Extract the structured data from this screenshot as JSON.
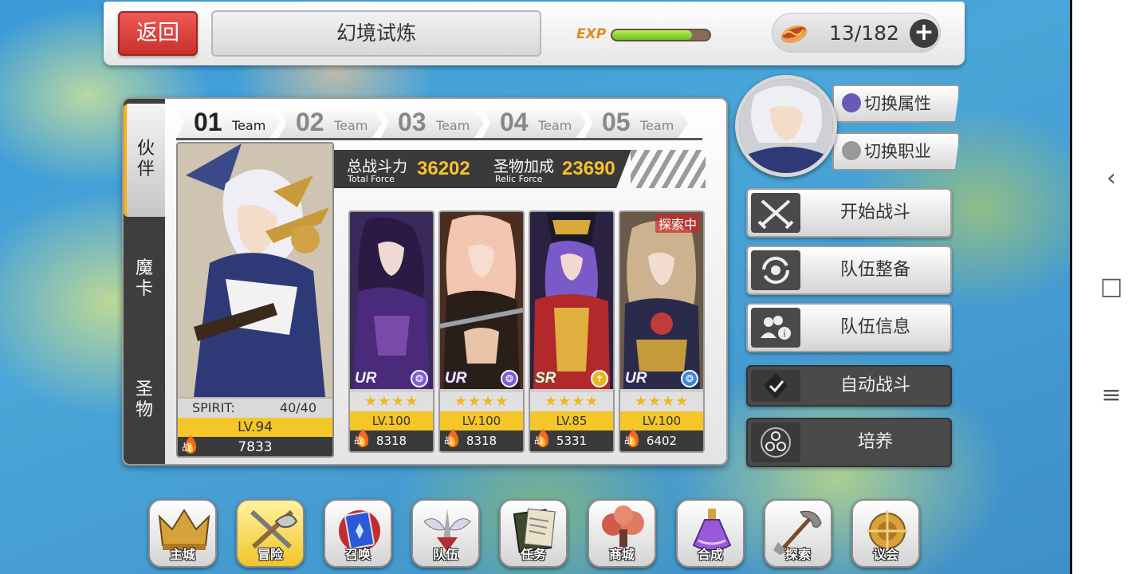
{
  "topbar": {
    "back_label": "返回",
    "title": "幻境试炼",
    "exp_label": "EXP",
    "exp_progress": 0.82,
    "stamina": "13/182",
    "plus_label": "+"
  },
  "side_tabs": [
    {
      "label": "伙\n伴",
      "active": true
    },
    {
      "label": "魔\n卡",
      "active": false
    },
    {
      "label": "圣\n物",
      "active": false
    }
  ],
  "teams": [
    {
      "num": "01",
      "word": "Team",
      "active": true
    },
    {
      "num": "02",
      "word": "Team",
      "active": false
    },
    {
      "num": "03",
      "word": "Team",
      "active": false
    },
    {
      "num": "04",
      "word": "Team",
      "active": false
    },
    {
      "num": "05",
      "word": "Team",
      "active": false
    }
  ],
  "force": {
    "total_label": "总战斗力",
    "total_sub": "Total Force",
    "total_value": "36202",
    "relic_label": "圣物加成",
    "relic_sub": "Relic Force",
    "relic_value": "23690"
  },
  "leader": {
    "spirit_label": "SPIRIT:",
    "spirit_value": "40/40",
    "level": "LV.94",
    "power": "7833",
    "power_mark": "战"
  },
  "members": [
    {
      "rarity": "UR",
      "stars": "★★★★",
      "level": "LV.100",
      "power": "8318",
      "power_mark": "战",
      "attr_color": "#7b5fd0",
      "badge": ""
    },
    {
      "rarity": "UR",
      "stars": "★★★★",
      "level": "LV.100",
      "power": "8318",
      "power_mark": "战",
      "attr_color": "#7b5fd0",
      "badge": ""
    },
    {
      "rarity": "SR",
      "stars": "★★★★",
      "level": "LV.85",
      "power": "5331",
      "power_mark": "战",
      "attr_color": "#e8b820",
      "badge": ""
    },
    {
      "rarity": "UR",
      "stars": "★★★★",
      "level": "LV.100",
      "power": "6402",
      "power_mark": "战",
      "attr_color": "#3f86d8",
      "badge": "探索中"
    }
  ],
  "switch_buttons": {
    "attribute": "切换属性",
    "job": "切换职业"
  },
  "actions": [
    {
      "label": "开始战斗",
      "icon": "crossed-swords-icon",
      "dark": false
    },
    {
      "label": "队伍整备",
      "icon": "cycle-icon",
      "dark": false
    },
    {
      "label": "队伍信息",
      "icon": "team-info-icon",
      "dark": false
    },
    {
      "label": "自动战斗",
      "icon": "check-icon",
      "dark": true
    },
    {
      "label": "培养",
      "icon": "triad-icon",
      "dark": true
    }
  ],
  "dock": [
    {
      "label": "主城",
      "icon": "crown-icon",
      "active": false
    },
    {
      "label": "冒险",
      "icon": "swords-icon",
      "active": true
    },
    {
      "label": "召唤",
      "icon": "summon-card-icon",
      "active": false
    },
    {
      "label": "队伍",
      "icon": "winged-sword-icon",
      "active": false
    },
    {
      "label": "任务",
      "icon": "quest-book-icon",
      "active": false
    },
    {
      "label": "商城",
      "icon": "shop-tree-icon",
      "active": false
    },
    {
      "label": "合成",
      "icon": "potion-icon",
      "active": false
    },
    {
      "label": "探索",
      "icon": "shovel-icon",
      "active": false
    },
    {
      "label": "议会",
      "icon": "council-icon",
      "active": false
    }
  ],
  "nav": {
    "back": "‹",
    "home": "□",
    "menu": "≡"
  }
}
